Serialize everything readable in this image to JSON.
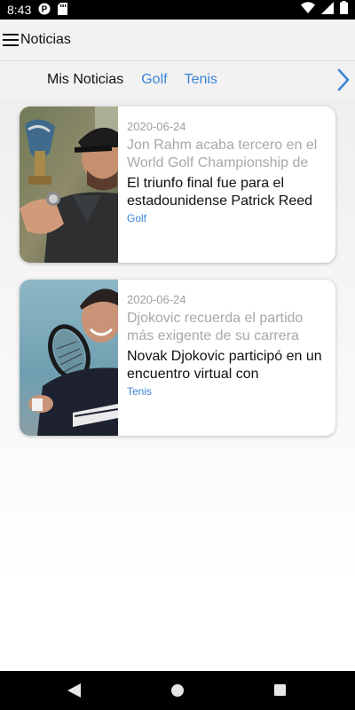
{
  "status_bar": {
    "time": "8:43",
    "icons": [
      "pinterest-notification-icon",
      "sd-card-icon",
      "wifi-icon",
      "cellular-signal-icon",
      "battery-icon"
    ]
  },
  "app_bar": {
    "title": "Noticias",
    "menu_icon": "hamburger-menu-icon"
  },
  "tabs": {
    "items": [
      {
        "label": "Mis Noticias",
        "active": true
      },
      {
        "label": "Golf",
        "active": false
      },
      {
        "label": "Tenis",
        "active": false
      }
    ],
    "next_icon": "chevron-right-icon"
  },
  "articles": [
    {
      "date": "2020-06-24",
      "headline": "Jon Rahm acaba tercero en el World Golf Championship de",
      "summary": "El triunfo final fue para el estadounidense Patrick Reed",
      "tag": "Golf",
      "image": "golfer-holding-trophy-photo"
    },
    {
      "date": "2020-06-24",
      "headline": "Djokovic recuerda el partido más exigente de su carrera",
      "summary": "Novak Djokovic participó en un encuentro virtual con",
      "tag": "Tenis",
      "image": "tennis-player-with-racket-photo"
    }
  ],
  "nav_bar": {
    "back_icon": "back-triangle-icon",
    "home_icon": "home-circle-icon",
    "recents_icon": "recents-square-icon"
  },
  "colors": {
    "accent": "#3b84d6",
    "app_bar_bg": "#f2f2f2",
    "muted_text": "#a8a8a8"
  }
}
